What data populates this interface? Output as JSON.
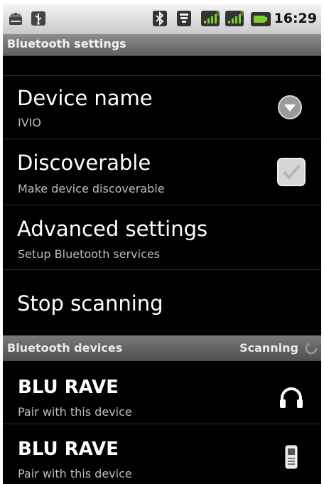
{
  "statusbar": {
    "time": "16:29",
    "icons": [
      "android-icon",
      "usb-icon",
      "bluetooth-icon",
      "wifi-icon",
      "signal-icon",
      "signal-icon",
      "battery-icon"
    ]
  },
  "title": "Bluetooth settings",
  "settings": {
    "device_name": {
      "label": "Device name",
      "value": "IVIO"
    },
    "discoverable": {
      "label": "Discoverable",
      "summary": "Make device discoverable",
      "checked": true
    },
    "advanced": {
      "label": "Advanced settings",
      "summary": "Setup Bluetooth services"
    },
    "scan": {
      "label": "Stop scanning"
    }
  },
  "devices_section": {
    "label": "Bluetooth devices",
    "status": "Scanning"
  },
  "devices": [
    {
      "name": "BLU RAVE",
      "action": "Pair with this device",
      "icon": "headphones-icon"
    },
    {
      "name": "BLU RAVE",
      "action": "Pair with this device",
      "icon": "phone-icon"
    }
  ],
  "colors": {
    "background": "#000000",
    "accent_green": "#7ad12a",
    "divider": "#2f2f2f"
  }
}
